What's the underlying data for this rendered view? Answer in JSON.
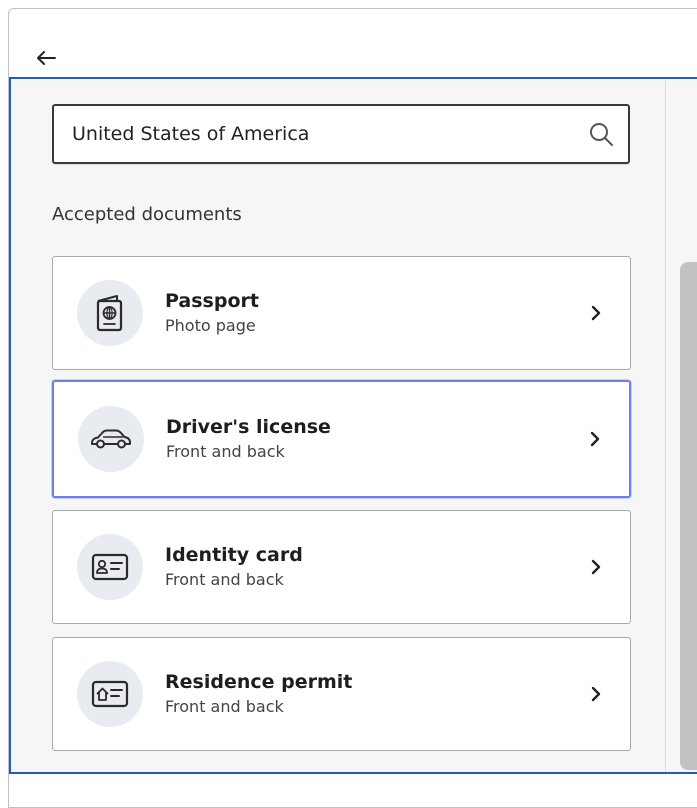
{
  "header": {
    "back_icon": "arrow-left-icon"
  },
  "search": {
    "value": "United States of America",
    "icon": "search-icon"
  },
  "section": {
    "label": "Accepted documents"
  },
  "documents": [
    {
      "title": "Passport",
      "subtitle": "Photo page",
      "icon": "passport-icon"
    },
    {
      "title": "Driver's license",
      "subtitle": "Front and back",
      "icon": "car-icon"
    },
    {
      "title": "Identity card",
      "subtitle": "Front and back",
      "icon": "id-card-icon"
    },
    {
      "title": "Residence permit",
      "subtitle": "Front and back",
      "icon": "residence-permit-icon"
    }
  ],
  "colors": {
    "focus_border": "#6f7fe8",
    "panel_border": "#1f5fb4",
    "icon_bg": "#e8ebef"
  }
}
